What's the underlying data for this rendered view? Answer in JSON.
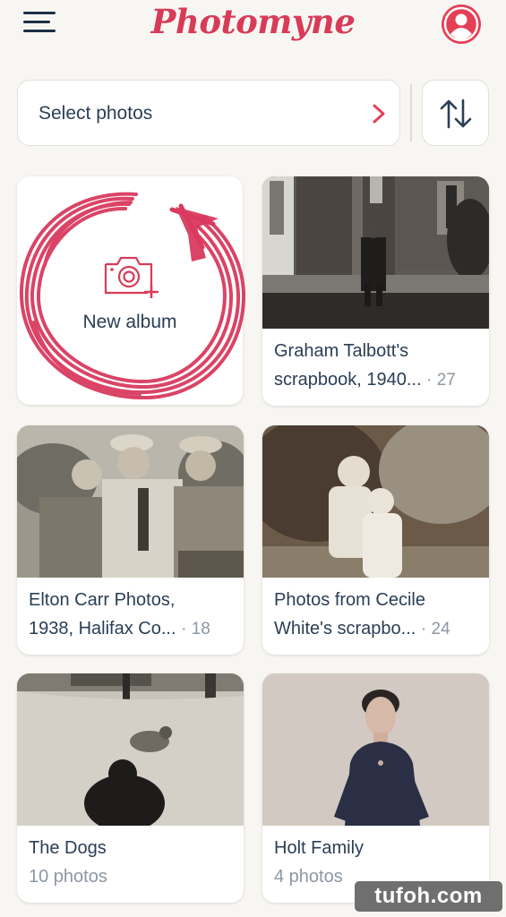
{
  "app": {
    "title": "Photomyne"
  },
  "header": {
    "menu_icon": "hamburger-menu-icon",
    "profile_icon": "user-avatar-icon"
  },
  "select_bar": {
    "label": "Select photos",
    "chevron_icon": "chevron-right-icon"
  },
  "sort_button": {
    "icon": "sort-arrows-icon"
  },
  "new_album": {
    "label": "New album",
    "icon": "camera-plus-icon"
  },
  "albums": [
    {
      "title_line1": "Graham Talbott's",
      "title_line2": "scrapbook, 1940...",
      "count": "· 27"
    },
    {
      "title_line1": "Elton Carr Photos,",
      "title_line2": "1938, Halifax Co...",
      "count": "· 18"
    },
    {
      "title_line1": "Photos from Cecile",
      "title_line2": "White's scrapbo...",
      "count": "· 24"
    },
    {
      "title_line1": "The Dogs",
      "subtitle": "10 photos"
    },
    {
      "title_line1": "Holt Family",
      "subtitle": "4 photos"
    }
  ],
  "watermark": "tufoh.com",
  "colors": {
    "brand": "#d83b57",
    "text": "#2a3e55",
    "muted": "#8d97a2",
    "background": "#f7f6f2",
    "annotation": "#d93a5e"
  }
}
